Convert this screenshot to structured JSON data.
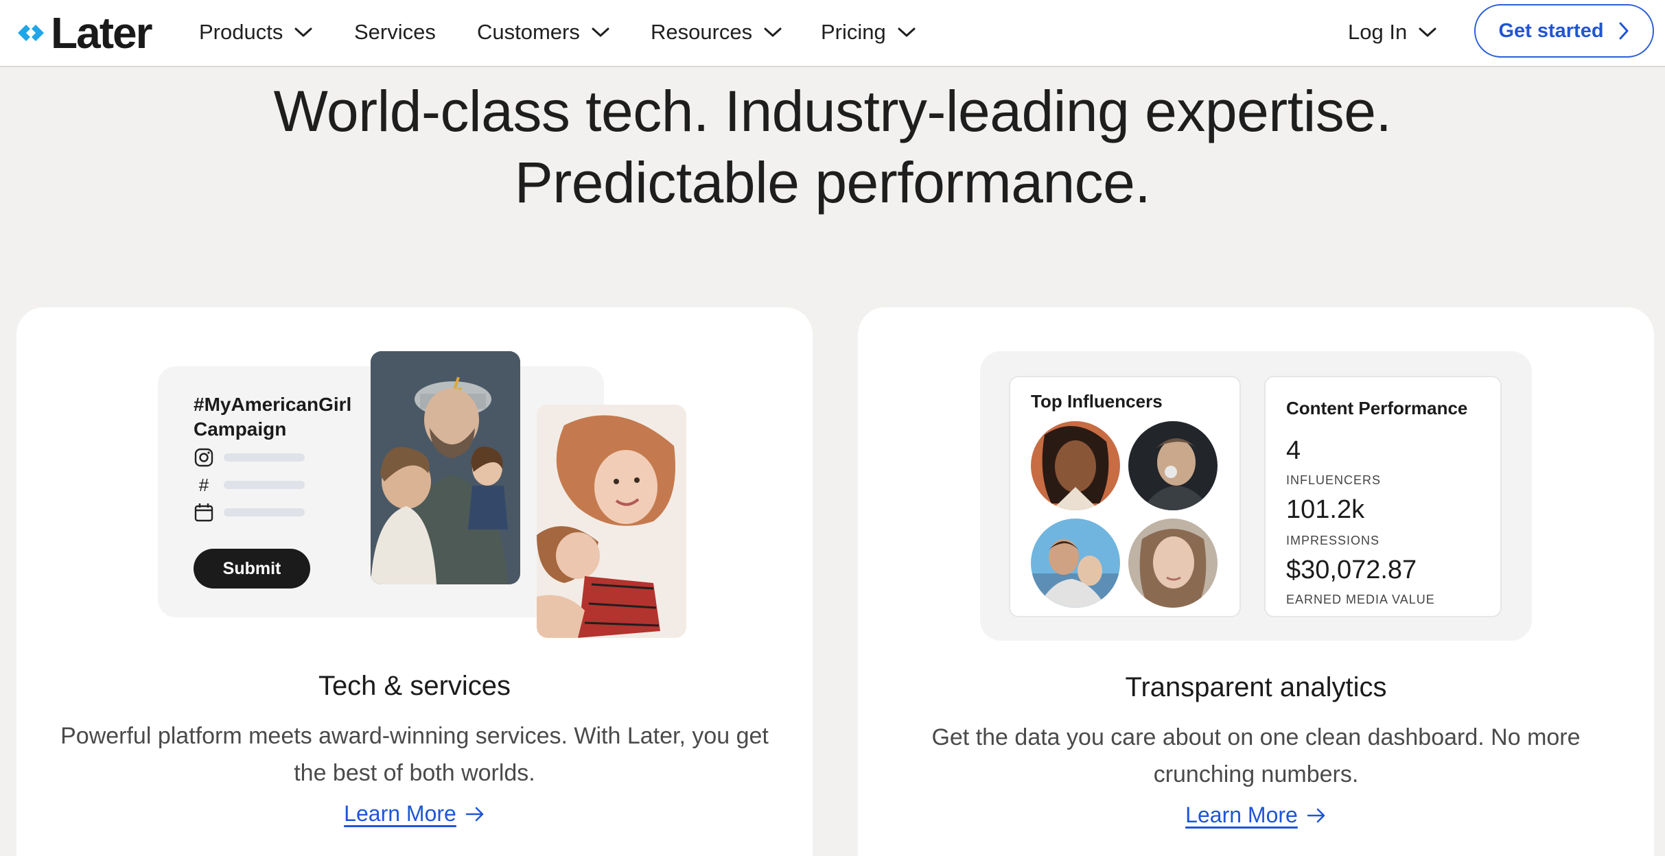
{
  "nav": {
    "logo_text": "Later",
    "items": [
      {
        "label": "Products",
        "has_dropdown": true
      },
      {
        "label": "Services",
        "has_dropdown": false
      },
      {
        "label": "Customers",
        "has_dropdown": true
      },
      {
        "label": "Resources",
        "has_dropdown": true
      },
      {
        "label": "Pricing",
        "has_dropdown": true
      }
    ],
    "login_label": "Log In",
    "cta_label": "Get started"
  },
  "hero": {
    "line1": "World-class tech. Industry-leading expertise.",
    "line2": "Predictable performance."
  },
  "cards": [
    {
      "title": "Tech & services",
      "description": "Powerful platform meets award-winning services. With Later, you get the best of both worlds.",
      "link_label": "Learn More",
      "illustration": {
        "campaign_title": "#MyAmericanGirl Campaign",
        "row_icons": [
          "instagram-icon",
          "hashtag-icon",
          "calendar-icon"
        ],
        "submit_label": "Submit"
      }
    },
    {
      "title": "Transparent analytics",
      "description": "Get the data you care about on one clean dashboard. No more crunching numbers.",
      "link_label": "Learn More",
      "illustration": {
        "top_influencers_title": "Top Influencers",
        "content_performance_title": "Content Performance",
        "stats": [
          {
            "value": "4",
            "label": "INFLUENCERS"
          },
          {
            "value": "101.2k",
            "label": "IMPRESSIONS"
          },
          {
            "value": "$30,072.87",
            "label": "EARNED MEDIA VALUE"
          }
        ]
      }
    }
  ],
  "colors": {
    "accent_blue": "#2154d6",
    "logo_cyan": "#1fa6e8",
    "page_bg": "#f2f1ef"
  }
}
